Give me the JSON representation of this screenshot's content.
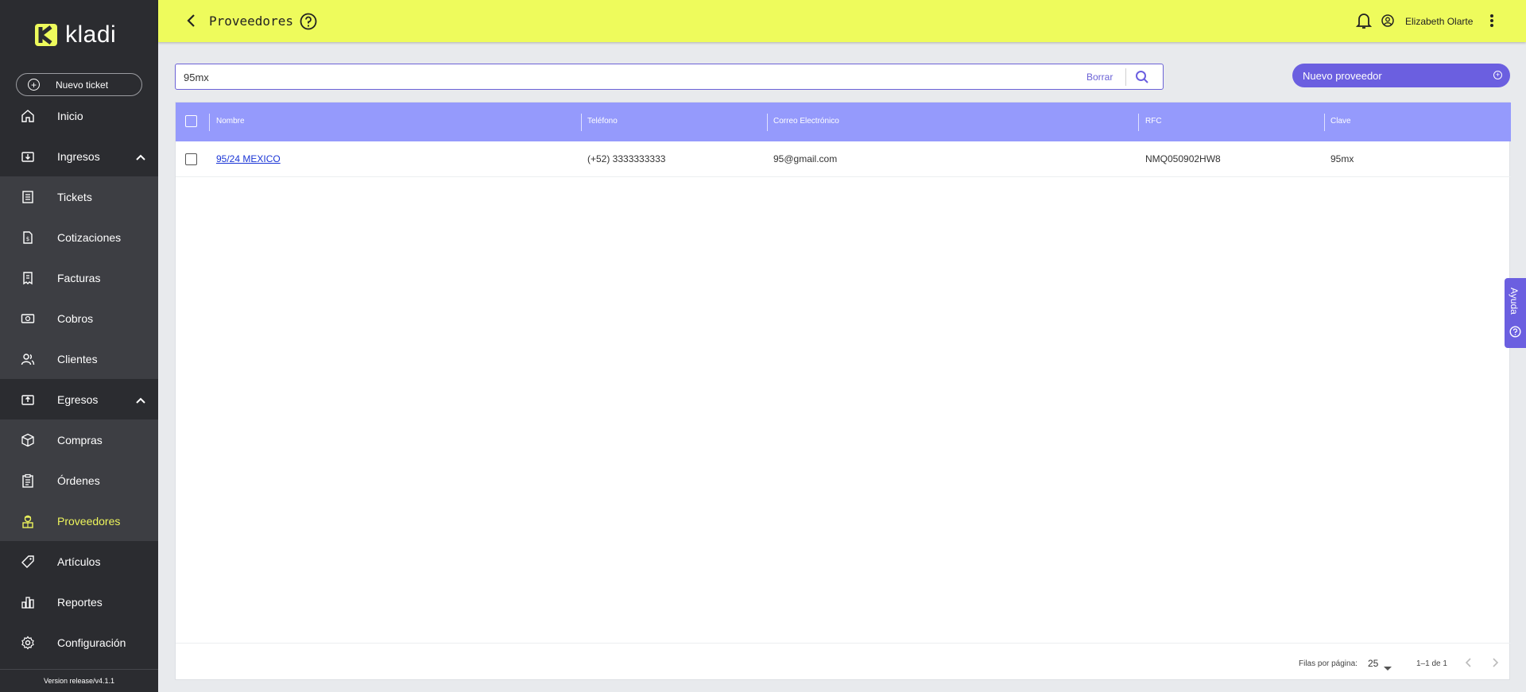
{
  "brand": {
    "name": "kladi",
    "accent": "#eefb5c",
    "primary": "#6b5fe0"
  },
  "sidebar": {
    "new_ticket": "Nuevo ticket",
    "items": [
      {
        "label": "Inicio",
        "icon": "home-icon"
      },
      {
        "label": "Ingresos",
        "icon": "ingresos-icon"
      },
      {
        "label": "Tickets",
        "icon": "ticket-icon"
      },
      {
        "label": "Cotizaciones",
        "icon": "quote-icon"
      },
      {
        "label": "Facturas",
        "icon": "invoice-icon"
      },
      {
        "label": "Cobros",
        "icon": "money-icon"
      },
      {
        "label": "Clientes",
        "icon": "users-icon"
      },
      {
        "label": "Egresos",
        "icon": "egresos-icon"
      },
      {
        "label": "Compras",
        "icon": "box-icon"
      },
      {
        "label": "Órdenes",
        "icon": "clipboard-icon"
      },
      {
        "label": "Proveedores",
        "icon": "supplier-icon"
      },
      {
        "label": "Artículos",
        "icon": "tag-icon"
      },
      {
        "label": "Reportes",
        "icon": "chart-icon"
      },
      {
        "label": "Configuración",
        "icon": "gear-icon"
      }
    ],
    "version": "Version release/v4.1.1"
  },
  "header": {
    "title": "Proveedores",
    "user": "Elizabeth Olarte"
  },
  "search": {
    "value": "95mx",
    "clear_label": "Borrar"
  },
  "new_button": "Nuevo proveedor",
  "table": {
    "columns": [
      "Nombre",
      "Teléfono",
      "Correo Electrónico",
      "RFC",
      "Clave"
    ],
    "rows": [
      [
        "95/24 MEXICO",
        "(+52) 3333333333",
        "95@gmail.com",
        "NMQ050902HW8",
        "95mx"
      ]
    ],
    "footer": {
      "rows_per_page_label": "Filas por página:",
      "rows_per_page": "25",
      "range": "1–1 de 1"
    }
  },
  "help_tab": "Ayuda"
}
